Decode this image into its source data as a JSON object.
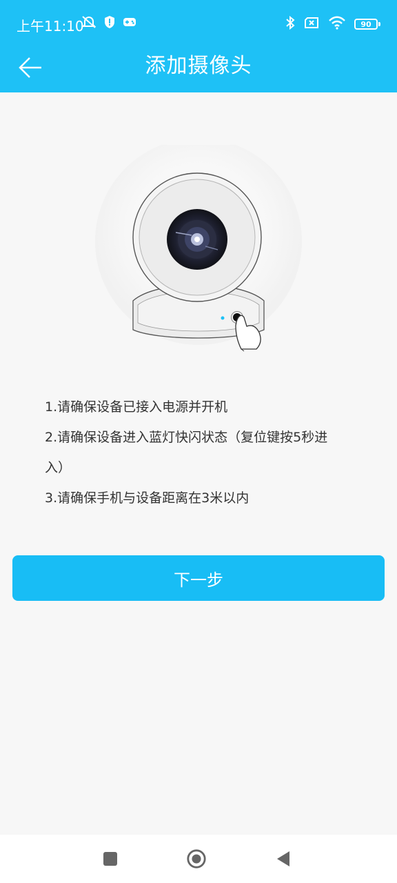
{
  "status_bar": {
    "time": "上午11:10",
    "battery": "90",
    "left_icons": [
      "mute-icon",
      "shield-icon",
      "game-icon"
    ],
    "right_icons": [
      "bluetooth-icon",
      "sim-off-icon",
      "wifi-icon",
      "battery-icon"
    ]
  },
  "header": {
    "title": "添加摄像头",
    "back_icon": "back-arrow-icon"
  },
  "instructions": [
    "1.请确保设备已接入电源并开机",
    "2.请确保设备进入蓝灯快闪状态（复位键按5秒进",
    "入）",
    "3.请确保手机与设备距离在3米以内"
  ],
  "next_button": {
    "label": "下一步"
  },
  "nav_bar": {
    "icons": [
      "recent-apps-icon",
      "home-icon",
      "back-icon"
    ]
  },
  "colors": {
    "accent": "#1ec1f6",
    "background": "#f7f7f7",
    "text": "#333333"
  }
}
